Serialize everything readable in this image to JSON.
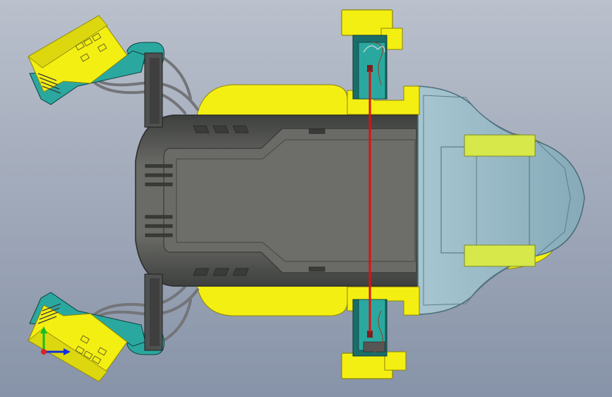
{
  "viewport": {
    "background_top": "#bac0cc",
    "background_bottom": "#8793a8"
  },
  "colors": {
    "yellow": "#f4ef12",
    "yellow_shade": "#c9c40e",
    "yellow_light": "#e8f25a",
    "body_dark": "#4f5150",
    "body_mid": "#6a6b67",
    "body_light": "#7d7e79",
    "teal": "#2aa8a0",
    "teal_dark": "#1a6e6a",
    "glass": "#8fb4c2",
    "glass_edge": "#5e7f8e",
    "cable": "#737579",
    "red_link": "#e01010"
  },
  "triad": {
    "x_axis_color": "#1030e0",
    "y_axis_color": "#10c020",
    "origin_color": "#e02020"
  },
  "icons": {
    "triad": "coordinate-triad-icon"
  }
}
